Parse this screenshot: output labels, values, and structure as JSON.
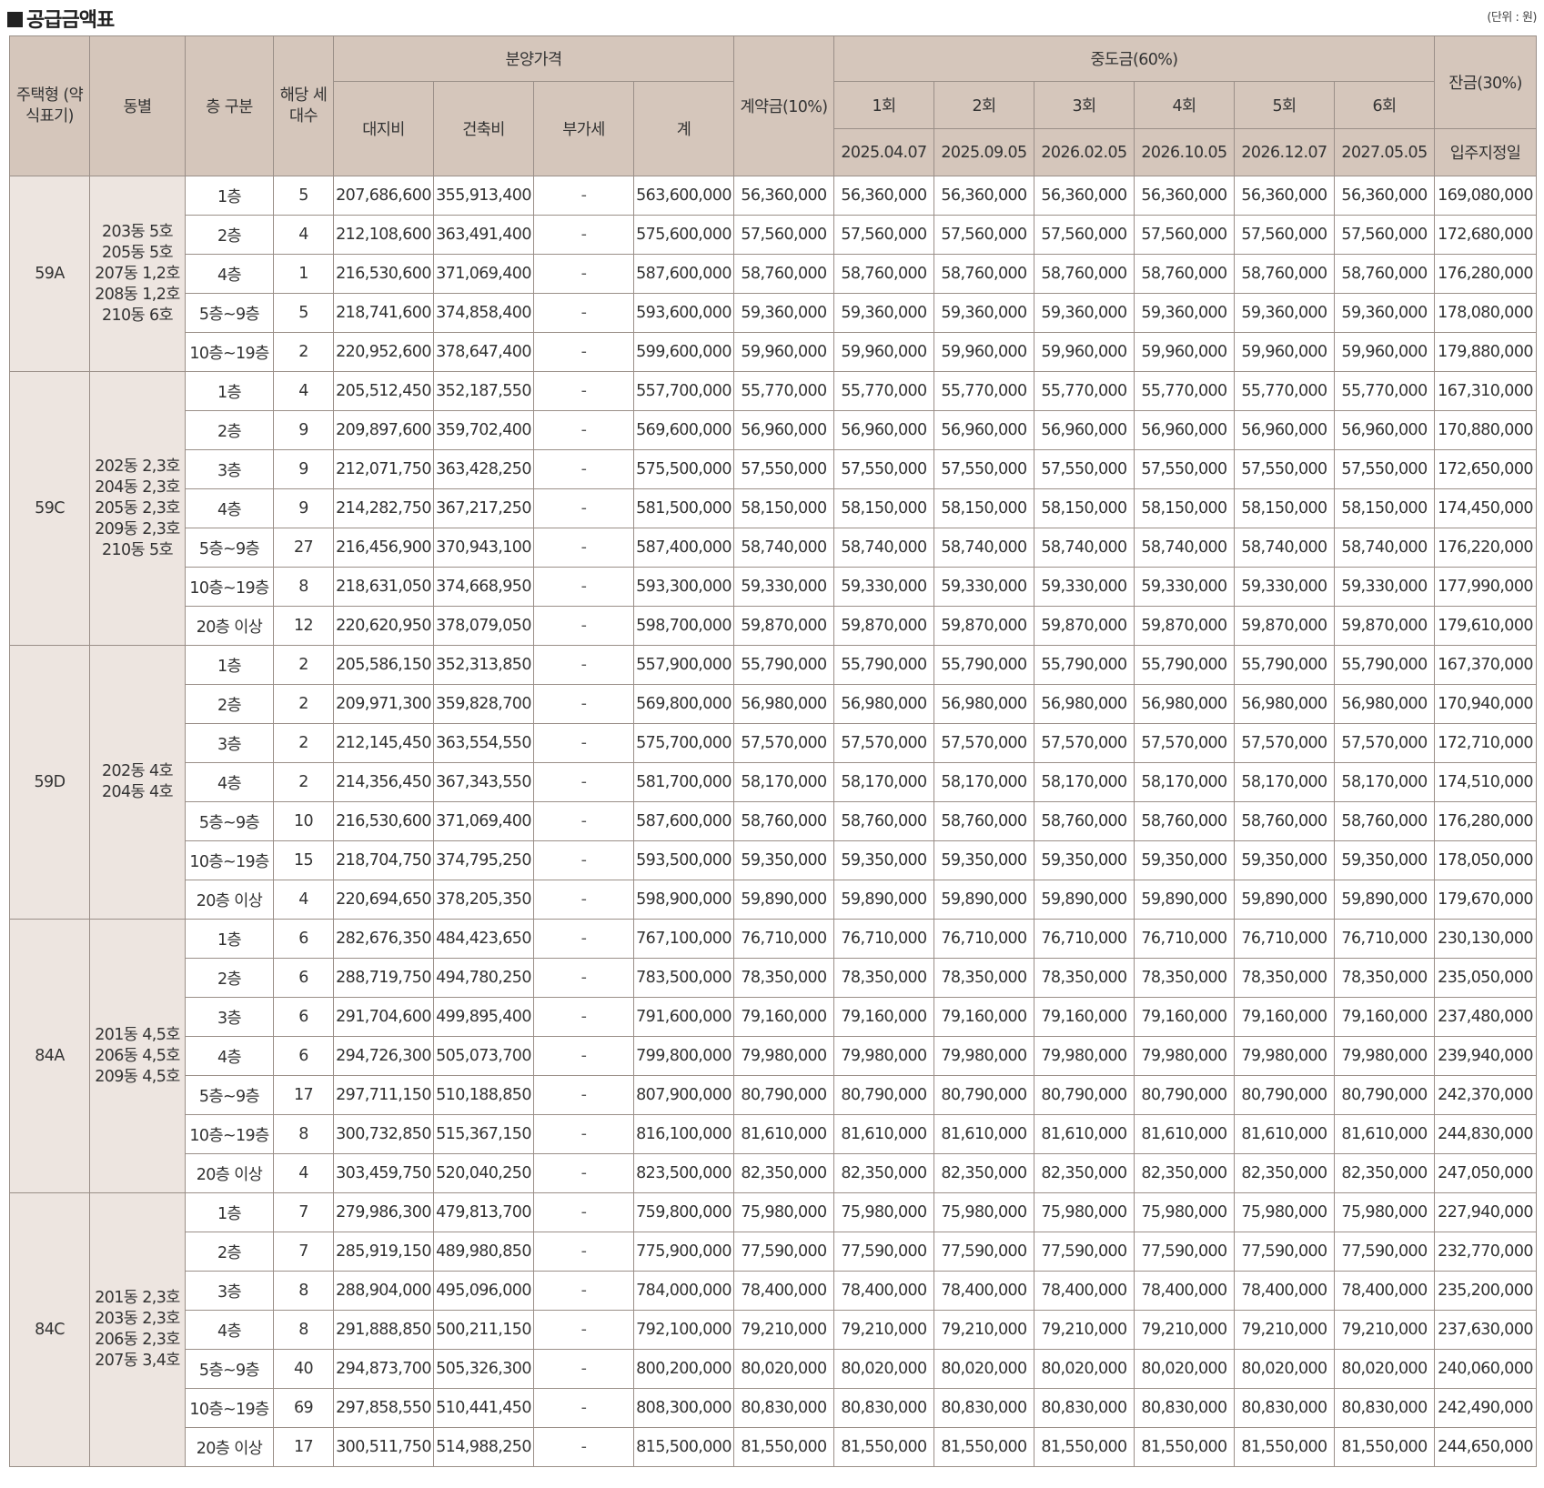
{
  "title": "공급금액표",
  "unit": "(단위 : 원)",
  "headers": {
    "type": "주택형 (약식표기)",
    "dong": "동별",
    "floor": "층 구분",
    "households": "해당 세대수",
    "price_group": "분양가격",
    "land": "대지비",
    "building": "건축비",
    "vat": "부가세",
    "total": "계",
    "deposit": "계약금(10%)",
    "middle_group": "중도금(60%)",
    "balance": "잔금(30%)",
    "rounds": [
      "1회",
      "2회",
      "3회",
      "4회",
      "5회",
      "6회"
    ],
    "dates": [
      "2025.04.07",
      "2025.09.05",
      "2026.02.05",
      "2026.10.05",
      "2026.12.07",
      "2027.05.05"
    ],
    "balance_date": "입주지정일"
  },
  "groups": [
    {
      "type": "59A",
      "dong": "203동 5호 205동 5호 207동 1,2호 208동 1,2호 210동 6호",
      "rows": [
        {
          "floor": "1층",
          "count": "5",
          "land": "207,686,600",
          "building": "355,913,400",
          "vat": "-",
          "total": "563,600,000",
          "deposit": "56,360,000",
          "balance": "169,080,000"
        },
        {
          "floor": "2층",
          "count": "4",
          "land": "212,108,600",
          "building": "363,491,400",
          "vat": "-",
          "total": "575,600,000",
          "deposit": "57,560,000",
          "balance": "172,680,000"
        },
        {
          "floor": "4층",
          "count": "1",
          "land": "216,530,600",
          "building": "371,069,400",
          "vat": "-",
          "total": "587,600,000",
          "deposit": "58,760,000",
          "balance": "176,280,000"
        },
        {
          "floor": "5층~9층",
          "count": "5",
          "land": "218,741,600",
          "building": "374,858,400",
          "vat": "-",
          "total": "593,600,000",
          "deposit": "59,360,000",
          "balance": "178,080,000"
        },
        {
          "floor": "10층~19층",
          "count": "2",
          "land": "220,952,600",
          "building": "378,647,400",
          "vat": "-",
          "total": "599,600,000",
          "deposit": "59,960,000",
          "balance": "179,880,000"
        }
      ]
    },
    {
      "type": "59C",
      "dong": "202동 2,3호 204동 2,3호 205동 2,3호 209동 2,3호 210동 5호",
      "rows": [
        {
          "floor": "1층",
          "count": "4",
          "land": "205,512,450",
          "building": "352,187,550",
          "vat": "-",
          "total": "557,700,000",
          "deposit": "55,770,000",
          "balance": "167,310,000"
        },
        {
          "floor": "2층",
          "count": "9",
          "land": "209,897,600",
          "building": "359,702,400",
          "vat": "-",
          "total": "569,600,000",
          "deposit": "56,960,000",
          "balance": "170,880,000"
        },
        {
          "floor": "3층",
          "count": "9",
          "land": "212,071,750",
          "building": "363,428,250",
          "vat": "-",
          "total": "575,500,000",
          "deposit": "57,550,000",
          "balance": "172,650,000"
        },
        {
          "floor": "4층",
          "count": "9",
          "land": "214,282,750",
          "building": "367,217,250",
          "vat": "-",
          "total": "581,500,000",
          "deposit": "58,150,000",
          "balance": "174,450,000"
        },
        {
          "floor": "5층~9층",
          "count": "27",
          "land": "216,456,900",
          "building": "370,943,100",
          "vat": "-",
          "total": "587,400,000",
          "deposit": "58,740,000",
          "balance": "176,220,000"
        },
        {
          "floor": "10층~19층",
          "count": "8",
          "land": "218,631,050",
          "building": "374,668,950",
          "vat": "-",
          "total": "593,300,000",
          "deposit": "59,330,000",
          "balance": "177,990,000"
        },
        {
          "floor": "20층 이상",
          "count": "12",
          "land": "220,620,950",
          "building": "378,079,050",
          "vat": "-",
          "total": "598,700,000",
          "deposit": "59,870,000",
          "balance": "179,610,000"
        }
      ]
    },
    {
      "type": "59D",
      "dong": "202동 4호 204동 4호",
      "rows": [
        {
          "floor": "1층",
          "count": "2",
          "land": "205,586,150",
          "building": "352,313,850",
          "vat": "-",
          "total": "557,900,000",
          "deposit": "55,790,000",
          "balance": "167,370,000"
        },
        {
          "floor": "2층",
          "count": "2",
          "land": "209,971,300",
          "building": "359,828,700",
          "vat": "-",
          "total": "569,800,000",
          "deposit": "56,980,000",
          "balance": "170,940,000"
        },
        {
          "floor": "3층",
          "count": "2",
          "land": "212,145,450",
          "building": "363,554,550",
          "vat": "-",
          "total": "575,700,000",
          "deposit": "57,570,000",
          "balance": "172,710,000"
        },
        {
          "floor": "4층",
          "count": "2",
          "land": "214,356,450",
          "building": "367,343,550",
          "vat": "-",
          "total": "581,700,000",
          "deposit": "58,170,000",
          "balance": "174,510,000"
        },
        {
          "floor": "5층~9층",
          "count": "10",
          "land": "216,530,600",
          "building": "371,069,400",
          "vat": "-",
          "total": "587,600,000",
          "deposit": "58,760,000",
          "balance": "176,280,000"
        },
        {
          "floor": "10층~19층",
          "count": "15",
          "land": "218,704,750",
          "building": "374,795,250",
          "vat": "-",
          "total": "593,500,000",
          "deposit": "59,350,000",
          "balance": "178,050,000"
        },
        {
          "floor": "20층 이상",
          "count": "4",
          "land": "220,694,650",
          "building": "378,205,350",
          "vat": "-",
          "total": "598,900,000",
          "deposit": "59,890,000",
          "balance": "179,670,000"
        }
      ]
    },
    {
      "type": "84A",
      "dong": "201동 4,5호 206동 4,5호 209동 4,5호",
      "rows": [
        {
          "floor": "1층",
          "count": "6",
          "land": "282,676,350",
          "building": "484,423,650",
          "vat": "-",
          "total": "767,100,000",
          "deposit": "76,710,000",
          "balance": "230,130,000"
        },
        {
          "floor": "2층",
          "count": "6",
          "land": "288,719,750",
          "building": "494,780,250",
          "vat": "-",
          "total": "783,500,000",
          "deposit": "78,350,000",
          "balance": "235,050,000"
        },
        {
          "floor": "3층",
          "count": "6",
          "land": "291,704,600",
          "building": "499,895,400",
          "vat": "-",
          "total": "791,600,000",
          "deposit": "79,160,000",
          "balance": "237,480,000"
        },
        {
          "floor": "4층",
          "count": "6",
          "land": "294,726,300",
          "building": "505,073,700",
          "vat": "-",
          "total": "799,800,000",
          "deposit": "79,980,000",
          "balance": "239,940,000"
        },
        {
          "floor": "5층~9층",
          "count": "17",
          "land": "297,711,150",
          "building": "510,188,850",
          "vat": "-",
          "total": "807,900,000",
          "deposit": "80,790,000",
          "balance": "242,370,000"
        },
        {
          "floor": "10층~19층",
          "count": "8",
          "land": "300,732,850",
          "building": "515,367,150",
          "vat": "-",
          "total": "816,100,000",
          "deposit": "81,610,000",
          "balance": "244,830,000"
        },
        {
          "floor": "20층 이상",
          "count": "4",
          "land": "303,459,750",
          "building": "520,040,250",
          "vat": "-",
          "total": "823,500,000",
          "deposit": "82,350,000",
          "balance": "247,050,000"
        }
      ]
    },
    {
      "type": "84C",
      "dong": "201동 2,3호 203동 2,3호 206동 2,3호 207동 3,4호",
      "rows": [
        {
          "floor": "1층",
          "count": "7",
          "land": "279,986,300",
          "building": "479,813,700",
          "vat": "-",
          "total": "759,800,000",
          "deposit": "75,980,000",
          "balance": "227,940,000"
        },
        {
          "floor": "2층",
          "count": "7",
          "land": "285,919,150",
          "building": "489,980,850",
          "vat": "-",
          "total": "775,900,000",
          "deposit": "77,590,000",
          "balance": "232,770,000"
        },
        {
          "floor": "3층",
          "count": "8",
          "land": "288,904,000",
          "building": "495,096,000",
          "vat": "-",
          "total": "784,000,000",
          "deposit": "78,400,000",
          "balance": "235,200,000"
        },
        {
          "floor": "4층",
          "count": "8",
          "land": "291,888,850",
          "building": "500,211,150",
          "vat": "-",
          "total": "792,100,000",
          "deposit": "79,210,000",
          "balance": "237,630,000"
        },
        {
          "floor": "5층~9층",
          "count": "40",
          "land": "294,873,700",
          "building": "505,326,300",
          "vat": "-",
          "total": "800,200,000",
          "deposit": "80,020,000",
          "balance": "240,060,000"
        },
        {
          "floor": "10층~19층",
          "count": "69",
          "land": "297,858,550",
          "building": "510,441,450",
          "vat": "-",
          "total": "808,300,000",
          "deposit": "80,830,000",
          "balance": "242,490,000"
        },
        {
          "floor": "20층 이상",
          "count": "17",
          "land": "300,511,750",
          "building": "514,988,250",
          "vat": "-",
          "total": "815,500,000",
          "deposit": "81,550,000",
          "balance": "244,650,000"
        }
      ]
    }
  ]
}
